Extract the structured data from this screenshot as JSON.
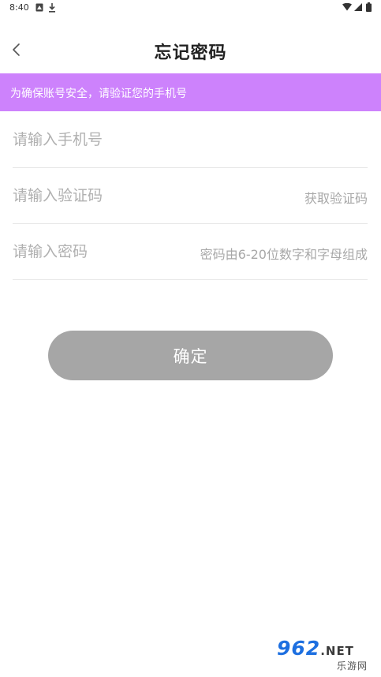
{
  "status_bar": {
    "time": "8:40"
  },
  "header": {
    "title": "忘记密码"
  },
  "banner": {
    "text": "为确保账号安全，请验证您的手机号"
  },
  "form": {
    "phone_placeholder": "请输入手机号",
    "code_placeholder": "请输入验证码",
    "get_code_label": "获取验证码",
    "password_placeholder": "请输入密码",
    "password_hint": "密码由6-20位数字和字母组成"
  },
  "confirm": {
    "label": "确定"
  },
  "watermark": {
    "brand": "962",
    "net": ".NET",
    "subtitle": "乐游网"
  },
  "colors": {
    "banner": "#cd82fc",
    "button": "#a6a6a6",
    "placeholder": "#b0b0b0"
  }
}
